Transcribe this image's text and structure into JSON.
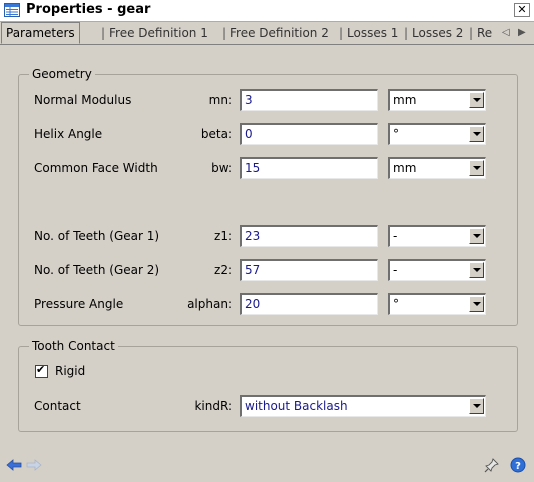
{
  "window": {
    "title": "Properties - gear",
    "close_label": "✕"
  },
  "tabs": [
    {
      "label": "Parameters"
    },
    {
      "label": "Free Definition 1"
    },
    {
      "label": "Free Definition 2"
    },
    {
      "label": "Losses 1"
    },
    {
      "label": "Losses 2"
    },
    {
      "label": "Re"
    }
  ],
  "geometry": {
    "legend": "Geometry",
    "rows": [
      {
        "label": "Normal Modulus",
        "var": "mn:",
        "value": "3",
        "unit": "mm"
      },
      {
        "label": "Helix Angle",
        "var": "beta:",
        "value": "0",
        "unit": "°"
      },
      {
        "label": "Common Face Width",
        "var": "bw:",
        "value": "15",
        "unit": "mm"
      },
      {
        "label": "No. of Teeth (Gear 1)",
        "var": "z1:",
        "value": "23",
        "unit": "-"
      },
      {
        "label": "No. of Teeth (Gear 2)",
        "var": "z2:",
        "value": "57",
        "unit": "-"
      },
      {
        "label": "Pressure Angle",
        "var": "alphan:",
        "value": "20",
        "unit": "°"
      }
    ]
  },
  "tooth_contact": {
    "legend": "Tooth Contact",
    "rigid_label": "Rigid",
    "rigid_checked": true,
    "contact_label": "Contact",
    "contact_var": "kindR:",
    "contact_value": "without Backlash"
  },
  "colors": {
    "background": "#d4d0c8",
    "value_text": "#1a1a8c",
    "nav_arrow": "#3a6fd8"
  }
}
